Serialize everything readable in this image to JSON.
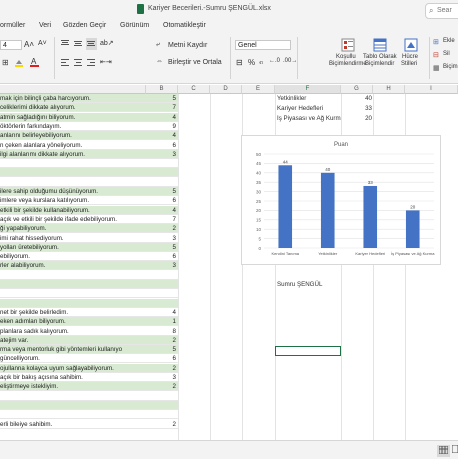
{
  "window": {
    "title": "Kariyer Becerileri.-Sumru ŞENGÜL.xlsx",
    "search_label": "Sear"
  },
  "menu_tabs": [
    "ormüller",
    "Veri",
    "Gözden Geçir",
    "Görünüm",
    "Otomatikleştir"
  ],
  "ribbon": {
    "font_size": "4",
    "align_label": "Metni Kaydır",
    "merge_label": "Birleştir ve Ortala",
    "number_format": "Genel",
    "cond_format_label": [
      "Koşullu",
      "Biçimlendirme"
    ],
    "table_format_label": [
      "Tablo Olarak",
      "Biçimlendir"
    ],
    "cell_styles_label": [
      "Hücre",
      "Stilleri"
    ],
    "right_labels": [
      "Ekle",
      "Sil",
      "Biçim"
    ]
  },
  "columns": {
    "B": "B",
    "C": "C",
    "D": "D",
    "E": "E",
    "F": "F",
    "G": "G",
    "H": "H",
    "I": "I"
  },
  "rows": [
    {
      "a": "mak için bilinçli çaba harcıyorum.",
      "b": "5",
      "green": true
    },
    {
      "a": "celiklerimi dikkate alıyorum.",
      "b": "7",
      "green": true
    },
    {
      "a": "atmin sağladığını biliyorum.",
      "b": "4",
      "green": true
    },
    {
      "a": "öktörlerin farkındayım.",
      "b": "9",
      "green": false
    },
    {
      "a": "anlarını belirleyebiliyorum.",
      "b": "4",
      "green": true
    },
    {
      "a": "n çeken alanlara yöneliyorum.",
      "b": "6",
      "green": false
    },
    {
      "a": "ilgi alanlarımı dikkate alıyorum.",
      "b": "3",
      "green": true
    },
    {
      "a": "",
      "b": "",
      "green": false
    },
    {
      "a": "",
      "b": "",
      "green": true
    },
    {
      "a": "",
      "b": "",
      "green": false
    },
    {
      "a": "ilere sahip olduğumu düşünüyorum.",
      "b": "5",
      "green": true
    },
    {
      "a": "imlere veya kurslara katılıyorum.",
      "b": "6",
      "green": false
    },
    {
      "a": "etkili bir şekilde kullanabiliyorum.",
      "b": "4",
      "green": true
    },
    {
      "a": "açık ve etkili bir şekilde ifade edebiliyorum.",
      "b": "7",
      "green": false
    },
    {
      "a": "ği yapabiliyorum.",
      "b": "2",
      "green": true
    },
    {
      "a": "imi rahat hissediyorum.",
      "b": "3",
      "green": false
    },
    {
      "a": "yolları üretebiliyorum.",
      "b": "5",
      "green": true
    },
    {
      "a": "ebiliyorum.",
      "b": "6",
      "green": false
    },
    {
      "a": "rler alabiliyorum.",
      "b": "3",
      "green": true
    },
    {
      "a": "",
      "b": "",
      "green": false
    },
    {
      "a": "",
      "b": "",
      "green": true
    },
    {
      "a": "",
      "b": "",
      "green": false
    },
    {
      "a": "",
      "b": "",
      "green": true
    },
    {
      "a": "net bir şekilde belirledim.",
      "b": "4",
      "green": false
    },
    {
      "a": "eken adımları biliyorum.",
      "b": "1",
      "green": true
    },
    {
      "a": "planlara sadık kalıyorum.",
      "b": "8",
      "green": false
    },
    {
      "a": "atejim var.",
      "b": "2",
      "green": true
    },
    {
      "a": "rma veya mentorluk gibi yöntemleri kullanıyo",
      "b": "5",
      "green": true
    },
    {
      "a": "güncelliyorum.",
      "b": "6",
      "green": false
    },
    {
      "a": "ojullanna kolayca uyum sağlayabiliyorum.",
      "b": "2",
      "green": true
    },
    {
      "a": "açık bir bakış açısına sahibim.",
      "b": "3",
      "green": false
    },
    {
      "a": "eliştirmeye istekliyim.",
      "b": "2",
      "green": true
    },
    {
      "a": "",
      "b": "",
      "green": false
    },
    {
      "a": "",
      "b": "",
      "green": true
    },
    {
      "a": "",
      "b": "",
      "green": false
    },
    {
      "a": "erli bileiye sahibim.",
      "b": "2",
      "green": false
    }
  ],
  "summary": [
    {
      "label": "Yetkinlikler",
      "value": "40"
    },
    {
      "label": "Kariyer Hedefleri",
      "value": "33"
    },
    {
      "label": "İş Piyasası ve Ağ Kurma",
      "value": "20"
    }
  ],
  "author_cell": "Sumru ŞENGÜL",
  "colors": {
    "bar": "#4472c4",
    "green_row": "#d9ead3",
    "accent": "#1e7145"
  },
  "chart_data": {
    "type": "bar",
    "title": "Puan",
    "categories": [
      "Kendini Tanıma",
      "Yetkinlikler",
      "Kariyer Hedefleri",
      "İş Piyasası ve Ağ Kurma"
    ],
    "values": [
      44,
      40,
      33,
      20
    ],
    "ylim": [
      0,
      50
    ],
    "yticks": [
      0,
      5,
      10,
      15,
      20,
      25,
      30,
      35,
      40,
      45,
      50
    ],
    "grid": true
  }
}
